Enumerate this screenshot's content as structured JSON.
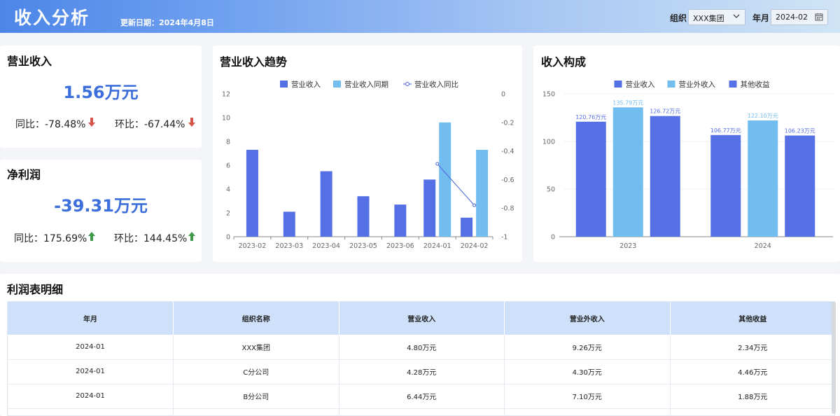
{
  "header": {
    "title": "收入分析",
    "update_date": "更新日期：2024年4月8日",
    "org_label": "组织",
    "org_value": "XXX集团",
    "month_label": "年月",
    "month_value": "2024-02"
  },
  "revenue_card": {
    "title": "营业收入",
    "value": "1.56万元",
    "yoy": "同比：-78.48%",
    "mom": "环比：-67.44%",
    "yoy_direction": "down",
    "mom_direction": "down",
    "down_color": "#d2544a"
  },
  "profit_card": {
    "title": "净利润",
    "value": "-39.31万元",
    "yoy": "同比：175.69%",
    "mom": "环比：144.45%",
    "yoy_direction": "up",
    "mom_direction": "up",
    "up_color": "#3f9a4a"
  },
  "trend_card": {
    "title": "营业收入趋势"
  },
  "composition_card": {
    "title": "收入构成"
  },
  "chart_data": [
    {
      "type": "bar",
      "title": "营业收入趋势",
      "categories": [
        "2023-02",
        "2023-03",
        "2023-04",
        "2023-05",
        "2023-06",
        "2024-01",
        "2024-02"
      ],
      "series": [
        {
          "name": "营业收入",
          "type": "bar",
          "color": "#5470e4",
          "values": [
            7.3,
            2.1,
            5.5,
            3.4,
            2.7,
            4.8,
            1.6
          ]
        },
        {
          "name": "营业收入同期",
          "type": "bar",
          "color": "#72bdf0",
          "values": [
            null,
            null,
            null,
            null,
            null,
            9.6,
            7.3
          ]
        },
        {
          "name": "营业收入同比",
          "type": "line",
          "axis": "right",
          "color": "#4a63d8",
          "values": [
            null,
            null,
            null,
            null,
            null,
            -0.49,
            -0.78
          ]
        }
      ],
      "y_left": {
        "min": 0,
        "max": 12,
        "ticks": [
          "0",
          "2",
          "4",
          "6",
          "8",
          "10",
          "12"
        ]
      },
      "y_right": {
        "min": -1,
        "max": 0,
        "ticks": [
          "0",
          "-0.2",
          "-0.4",
          "-0.6",
          "-0.8",
          "-1"
        ]
      },
      "legend": "top-center"
    },
    {
      "type": "bar",
      "title": "收入构成",
      "categories": [
        "2023",
        "2024"
      ],
      "series": [
        {
          "name": "营业收入",
          "color": "#5470e4",
          "values": [
            120.76,
            106.77
          ],
          "labels": [
            "120.76万元",
            "106.77万元"
          ]
        },
        {
          "name": "营业外收入",
          "color": "#72bdf0",
          "values": [
            135.79,
            122.1
          ],
          "labels": [
            "135.79万元",
            "122.10万元"
          ]
        },
        {
          "name": "其他收益",
          "color": "#5470e4",
          "values": [
            126.72,
            106.23
          ],
          "labels": [
            "126.72万元",
            "106.23万元"
          ]
        }
      ],
      "y": {
        "min": 0,
        "max": 150,
        "ticks": [
          "0",
          "50",
          "100",
          "150"
        ]
      },
      "legend": "top-center"
    }
  ],
  "table": {
    "title": "利润表明细",
    "columns": [
      "年月",
      "组织名称",
      "营业收入",
      "营业外收入",
      "其他收益"
    ],
    "rows": [
      [
        "2024-01",
        "XXX集团",
        "4.80万元",
        "9.26万元",
        "2.34万元"
      ],
      [
        "2024-01",
        "C分公司",
        "4.28万元",
        "4.30万元",
        "4.46万元"
      ],
      [
        "2024-01",
        "B分公司",
        "6.44万元",
        "7.10万元",
        "1.88万元"
      ],
      [
        "",
        "",
        "",
        "",
        ""
      ]
    ]
  }
}
